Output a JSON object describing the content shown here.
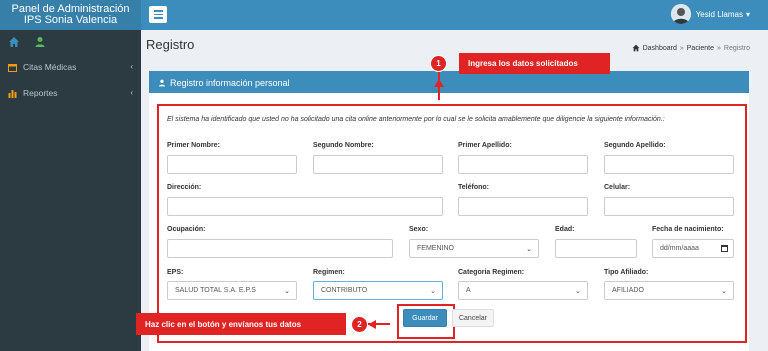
{
  "sidebar": {
    "brand_line1": "Panel de Administración",
    "brand_line2": "IPS Sonia Valencia",
    "icons": [
      "home-icon",
      "user-icon"
    ],
    "items": [
      {
        "label": "Citas Médicas",
        "icon": "calendar-icon"
      },
      {
        "label": "Reportes",
        "icon": "bar-chart-icon"
      }
    ]
  },
  "header": {
    "menu_toggle_icon": "hamburger-icon",
    "user_name": "Yesid Llamas",
    "user_caret": "▾"
  },
  "page": {
    "title": "Registro",
    "breadcrumb": [
      "Dashboard",
      "Paciente",
      "Registro"
    ]
  },
  "box": {
    "title": "Registro información personal",
    "notice": "El sistema ha identificado que usted no ha solicitado una cita online anteriormente por lo cual se le solicita amablemente que diligencie la siguiente información.:"
  },
  "form": {
    "primer_nombre": {
      "label": "Primer Nombre:",
      "value": ""
    },
    "segundo_nombre": {
      "label": "Segundo Nombre:",
      "value": ""
    },
    "primer_apellido": {
      "label": "Primer Apellido:",
      "value": ""
    },
    "segundo_apellido": {
      "label": "Segundo Apellido:",
      "value": ""
    },
    "direccion": {
      "label": "Dirección:",
      "value": ""
    },
    "telefono": {
      "label": "Teléfono:",
      "value": ""
    },
    "celular": {
      "label": "Celular:",
      "value": ""
    },
    "ocupacion": {
      "label": "Ocupación:",
      "value": ""
    },
    "sexo": {
      "label": "Sexo:",
      "value": "FEMENINO"
    },
    "edad": {
      "label": "Edad:",
      "value": ""
    },
    "fecha_nacimiento": {
      "label": "Fecha de nacimiento:",
      "placeholder": "dd/mm/aaaa"
    },
    "eps": {
      "label": "EPS:",
      "value": "SALUD TOTAL S.A. E.P.S"
    },
    "regimen": {
      "label": "Regimen:",
      "value": "CONTRIBUTO"
    },
    "categoria_regimen": {
      "label": "Categoria Regimen:",
      "value": "A"
    },
    "tipo_afiliado": {
      "label": "Tipo Afiliado:",
      "value": "AFILIADO"
    },
    "guardar": "Guardar",
    "cancelar": "Cancelar"
  },
  "annotations": {
    "step1_number": "1",
    "step1_text": "Ingresa los datos solicitados",
    "step2_number": "2",
    "step2_text": "Haz clic en el botón y envíanos tus datos"
  },
  "colors": {
    "sidebar_bg": "#2c3b41",
    "header_bg": "#3c8dbc",
    "annotation_red": "#e02424"
  }
}
